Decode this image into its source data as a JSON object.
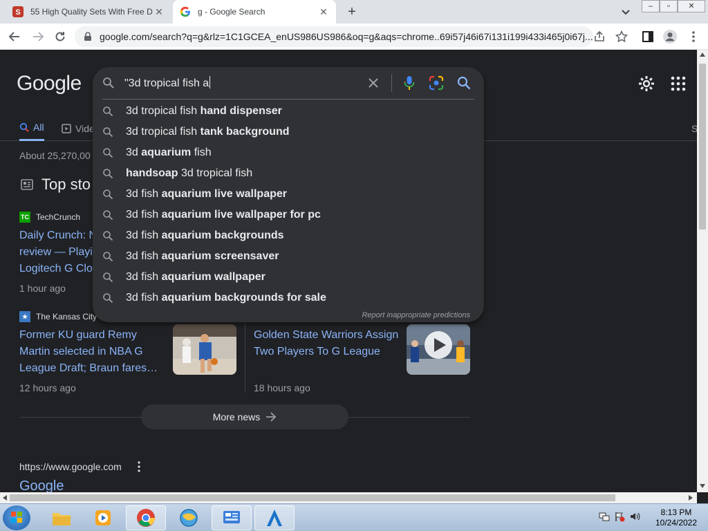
{
  "browser": {
    "tabs": [
      {
        "title": "55 High Quality Sets With Free D",
        "active": false
      },
      {
        "title": "g - Google Search",
        "active": true
      }
    ],
    "url": "google.com/search?q=g&rlz=1C1GCEA_enUS986US986&oq=g&aqs=chrome..69i57j46i67i131i199i433i465j0i67j..."
  },
  "search": {
    "query": "\"3d tropical fish a",
    "suggestions": [
      {
        "normal": "3d tropical fish ",
        "bold": "hand dispenser",
        "bold_first": false
      },
      {
        "normal": "3d tropical fish ",
        "bold": "tank background",
        "bold_first": false
      },
      {
        "normal": "3d ",
        "bold": "aquarium",
        "tail": " fish",
        "bold_first": false
      },
      {
        "bold": "handsoap",
        "normal": " 3d tropical fish",
        "bold_first": true
      },
      {
        "normal": "3d fish ",
        "bold": "aquarium live wallpaper",
        "bold_first": false
      },
      {
        "normal": "3d fish ",
        "bold": "aquarium live wallpaper for pc",
        "bold_first": false
      },
      {
        "normal": "3d fish ",
        "bold": "aquarium backgrounds",
        "bold_first": false
      },
      {
        "normal": "3d fish ",
        "bold": "aquarium screensaver",
        "bold_first": false
      },
      {
        "normal": "3d fish ",
        "bold": "aquarium wallpaper",
        "bold_first": false
      },
      {
        "normal": "3d fish ",
        "bold": "aquarium backgrounds for sale",
        "bold_first": false
      }
    ],
    "report_link": "Report inappropriate predictions"
  },
  "page": {
    "logo": "Google",
    "tabs": {
      "all": "All",
      "videos": "Vide",
      "right_edge": "S"
    },
    "result_stats": "About 25,270,00",
    "top_stories": "Top sto",
    "stories": [
      {
        "source": "TechCrunch",
        "lines": [
          "Daily Crunch: N",
          "review — Playi",
          "Logitech G Clo"
        ],
        "ago": "1 hour ago"
      },
      {
        "source": "The Kansas City",
        "lines": [
          "Former KU guard Remy",
          "Martin selected in NBA G",
          "League Draft; Braun fares…"
        ],
        "ago": "12 hours ago"
      },
      {
        "source": "",
        "lines": [
          "Golden State Warriors Assign",
          "Two Players To G League"
        ],
        "ago": "18 hours ago"
      }
    ],
    "more_news": "More news",
    "result_url": "https://www.google.com",
    "result_title": "Google"
  },
  "taskbar": {
    "time": "8:13 PM",
    "date": "10/24/2022"
  },
  "colors": {
    "page_bg": "#202124",
    "link": "#8ab4f8",
    "suggest_bg": "#303134"
  }
}
